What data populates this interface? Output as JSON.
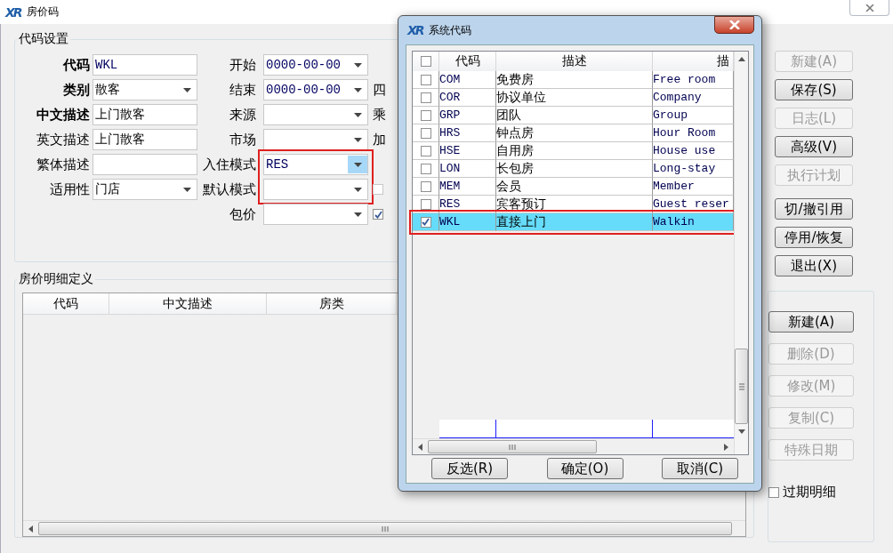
{
  "window": {
    "logo": "XR",
    "title": "房价码"
  },
  "code_group": {
    "title": "代码设置",
    "left_fields": [
      {
        "label": "代码",
        "bold": true,
        "kind": "text",
        "value": "WKL"
      },
      {
        "label": "类别",
        "bold": true,
        "kind": "dropdown",
        "value": "散客"
      },
      {
        "label": "中文描述",
        "bold": true,
        "kind": "text",
        "value": "上门散客"
      },
      {
        "label": "英文描述",
        "bold": false,
        "kind": "text",
        "value": "上门散客"
      },
      {
        "label": "繁体描述",
        "bold": false,
        "kind": "text"
      },
      {
        "label": "适用性",
        "bold": false,
        "kind": "dropdown",
        "value": "门店"
      }
    ],
    "right_fields": [
      {
        "label": "开始",
        "kind": "dropdown",
        "value": "0000-00-00",
        "highlighted": false,
        "focused": false
      },
      {
        "label": "结束",
        "kind": "dropdown",
        "value": "0000-00-00",
        "highlighted": false,
        "focused": false,
        "extra": {
          "kind": "text",
          "text": "四"
        }
      },
      {
        "label": "来源",
        "kind": "dropdown",
        "highlighted": false,
        "focused": false,
        "extra": {
          "kind": "text",
          "text": "乘"
        }
      },
      {
        "label": "市场",
        "kind": "dropdown",
        "highlighted": false,
        "focused": false,
        "extra": {
          "kind": "text",
          "text": "加"
        }
      },
      {
        "label": "入住模式",
        "kind": "dropdown",
        "value": "RES",
        "highlighted": true,
        "focused": true
      },
      {
        "label": "默认模式",
        "kind": "dropdown",
        "highlighted": true,
        "focused": false,
        "extra": {
          "kind": "checkbox",
          "checked": false
        }
      },
      {
        "label": "包价",
        "kind": "dropdown",
        "highlighted": false,
        "focused": false,
        "extra": {
          "kind": "checkbox",
          "checked": true
        }
      }
    ]
  },
  "detail_group": {
    "title": "房价明细定义",
    "columns": [
      "代码",
      "中文描述",
      "房类"
    ]
  },
  "button_groups": [
    [
      {
        "label": "新建(A)",
        "disabled": true
      },
      {
        "label": "保存(S)",
        "disabled": false
      },
      {
        "label": "日志(L)",
        "disabled": true
      },
      {
        "label": "高级(V)",
        "disabled": false
      },
      {
        "label": "执行计划",
        "disabled": true
      }
    ],
    [
      {
        "label": "切/撤引用",
        "disabled": false
      },
      {
        "label": "停用/恢复",
        "disabled": false
      },
      {
        "label": "退出(X)",
        "disabled": false
      }
    ]
  ],
  "detail_buttons": [
    {
      "label": "新建(A)",
      "disabled": false
    },
    {
      "label": "删除(D)",
      "disabled": true
    },
    {
      "label": "修改(M)",
      "disabled": true
    },
    {
      "label": "复制(C)",
      "disabled": true
    },
    {
      "label": "特殊日期",
      "disabled": true
    }
  ],
  "expired_checkbox": {
    "label": "过期明细",
    "checked": false
  },
  "dialog": {
    "logo": "XR",
    "title": "系统代码",
    "header_checked": false,
    "columns": [
      "代码",
      "描述",
      "描"
    ],
    "rows": [
      {
        "code": "COM",
        "desc": "免费房",
        "english": "Free room",
        "checked": false,
        "selected": false,
        "highlighted": false
      },
      {
        "code": "COR",
        "desc": "协议单位",
        "english": "Company",
        "checked": false,
        "selected": false,
        "highlighted": false
      },
      {
        "code": "GRP",
        "desc": "团队",
        "english": "Group",
        "checked": false,
        "selected": false,
        "highlighted": false
      },
      {
        "code": "HRS",
        "desc": "钟点房",
        "english": "Hour Room",
        "checked": false,
        "selected": false,
        "highlighted": false
      },
      {
        "code": "HSE",
        "desc": "自用房",
        "english": "House use",
        "checked": false,
        "selected": false,
        "highlighted": false
      },
      {
        "code": "LON",
        "desc": "长包房",
        "english": "Long-stay",
        "checked": false,
        "selected": false,
        "highlighted": false
      },
      {
        "code": "MEM",
        "desc": "会员",
        "english": "Member",
        "checked": false,
        "selected": false,
        "highlighted": false
      },
      {
        "code": "RES",
        "desc": "宾客预订",
        "english": "Guest reser",
        "checked": false,
        "selected": false,
        "highlighted": false
      },
      {
        "code": "WKL",
        "desc": "直接上门",
        "english": "Walkin",
        "checked": true,
        "selected": true,
        "highlighted": true
      }
    ],
    "buttons": [
      "反选(R)",
      "确定(O)",
      "取消(C)"
    ]
  }
}
